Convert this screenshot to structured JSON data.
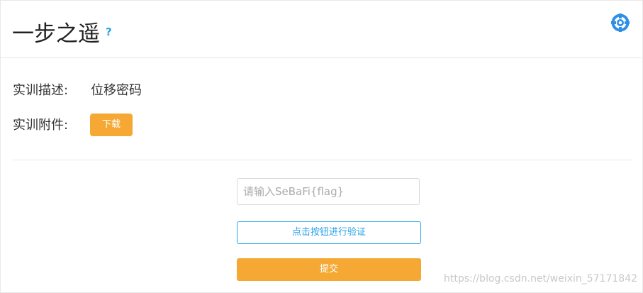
{
  "header": {
    "title": "一步之遥",
    "help_symbol": "?",
    "settings_icon": "lifebuoy-icon",
    "accent": "#2aa2e8"
  },
  "details": {
    "description_label": "实训描述:",
    "description_value": "位移密码",
    "attachment_label": "实训附件:",
    "download_label": "下载"
  },
  "form": {
    "flag_placeholder": "请输入SeBaFi{flag}",
    "flag_value": "",
    "verify_label": "点击按钮进行验证",
    "submit_label": "提交",
    "submit_color": "#f5a934"
  },
  "watermark": "https://blog.csdn.net/weixin_57171842"
}
